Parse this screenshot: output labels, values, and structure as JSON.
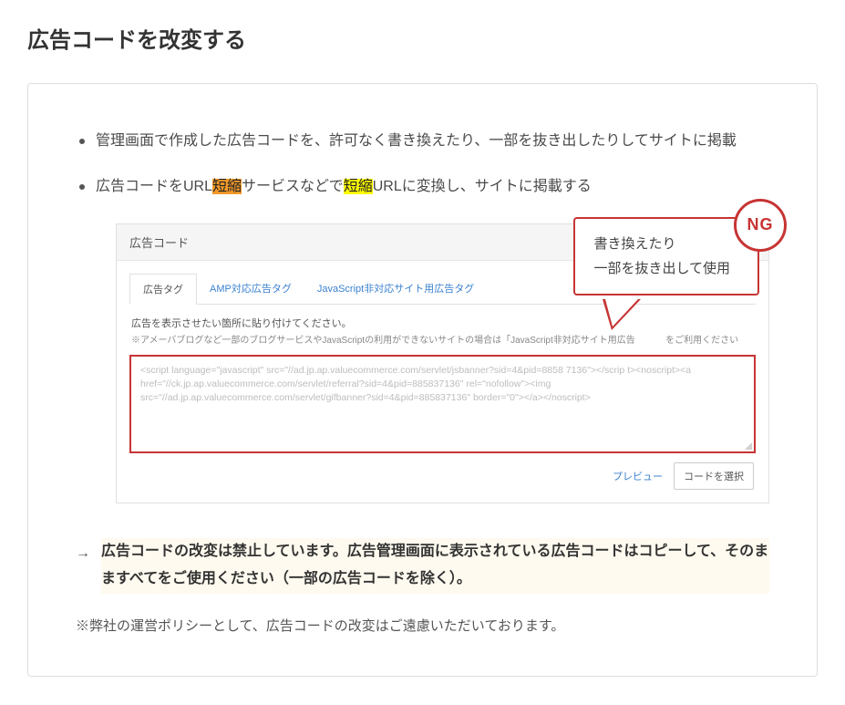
{
  "title": "広告コードを改変する",
  "bullets": {
    "b1_pre": "管理画面で作成した広告コードを、許可なく書き換えたり、一部を抜き出したりしてサイトに掲載",
    "b2_p1": "広告コードをURL",
    "b2_h1": "短縮",
    "b2_p2": "サービスなどで",
    "b2_h2": "短縮",
    "b2_p3": "URLに変換し、サイトに掲載する"
  },
  "panel": {
    "header": "広告コード",
    "tabs": {
      "active": "広告タグ",
      "amp": "AMP対応広告タグ",
      "nojs": "JavaScript非対応サイト用広告タグ"
    },
    "instruction": "広告を表示させたい箇所に貼り付けてください。",
    "note_pre": "※アメーバブログなど一部のブログサービスやJavaScriptの利用ができないサイトの場合は「JavaScript非対応サイト用広告",
    "note_post": "をご利用ください",
    "code_l1": "<script language=\"javascript\" src=\"//ad.jp.ap.valuecommerce.com/servlet/jsbanner?sid=4&pid=8858  7136\"></scrip t><noscript><a",
    "code_l2": "href=\"//ck.jp.ap.valuecommerce.com/servlet/referral?sid=4&pid=885837136\" rel=\"nofollow\"><img",
    "code_l3": "src=\"//ad.jp.ap.valuecommerce.com/servlet/gifbanner?sid=4&pid=885837136\" border=\"0\"></a></noscript>",
    "preview": "プレビュー",
    "select_btn": "コードを選択"
  },
  "callout": {
    "line1": "書き換えたり",
    "line2": "一部を抜き出して使用",
    "ng": "NG"
  },
  "arrow_sym": "→",
  "arrow_text": "広告コードの改変は禁止しています。広告管理画面に表示されている広告コードはコピーして、そのまますべてをご使用ください（一部の広告コードを除く）。",
  "disclaimer": "※弊社の運営ポリシーとして、広告コードの改変はご遠慮いただいております。"
}
